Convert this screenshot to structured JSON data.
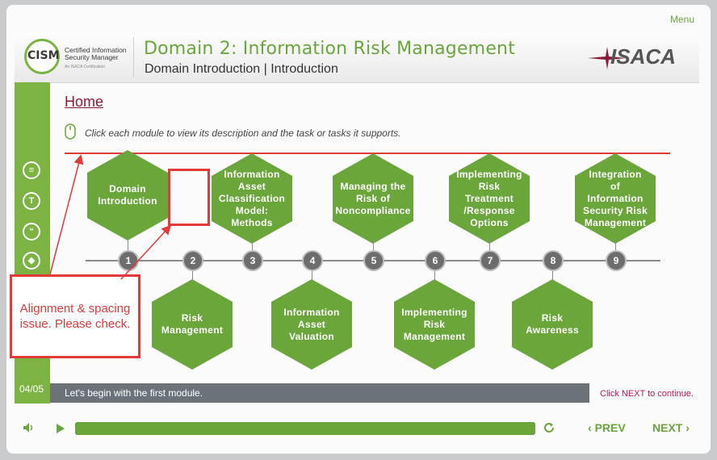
{
  "menu_label": "Menu",
  "header": {
    "logo_name": "CISM",
    "logo_line1": "Certified Information",
    "logo_line2": "Security Manager",
    "logo_tagline": "An ISACA Certification",
    "title": "Domain 2: Information Risk Management",
    "subtitle": "Domain Introduction | Introduction",
    "brand": "ISACA"
  },
  "sidebar": {
    "icons": [
      "notes-icon",
      "transcript-icon",
      "quote-icon",
      "layers-icon"
    ],
    "icon_glyphs": [
      "≡",
      "T",
      "“",
      "◈"
    ],
    "page_num": "04/05"
  },
  "content": {
    "home_link": "Home",
    "instruction": "Click each module to view its description and the task or tasks it supports."
  },
  "modules": [
    {
      "num": "1",
      "label": "Domain Introduction"
    },
    {
      "num": "2",
      "label": "Risk Management"
    },
    {
      "num": "3",
      "label": "Information Asset Classification Model: Methods"
    },
    {
      "num": "4",
      "label": "Information Asset Valuation"
    },
    {
      "num": "5",
      "label": "Managing the Risk of Noncompliance"
    },
    {
      "num": "6",
      "label": "Implementing Risk Management"
    },
    {
      "num": "7",
      "label": "Implementing Risk Treatment /Response Options"
    },
    {
      "num": "8",
      "label": "Risk Awareness"
    },
    {
      "num": "9",
      "label": "Integration of Information Security Risk Management"
    }
  ],
  "annotation": {
    "text": "Alignment & spacing issue. Please check."
  },
  "status": {
    "message": "Let's begin with the first module.",
    "next_hint": "Click NEXT to continue."
  },
  "player": {
    "progress": 1.0,
    "prev_label": "PREV",
    "next_label": "NEXT"
  },
  "colors": {
    "accent": "#6aa63a",
    "annotation": "#e23a3a"
  }
}
